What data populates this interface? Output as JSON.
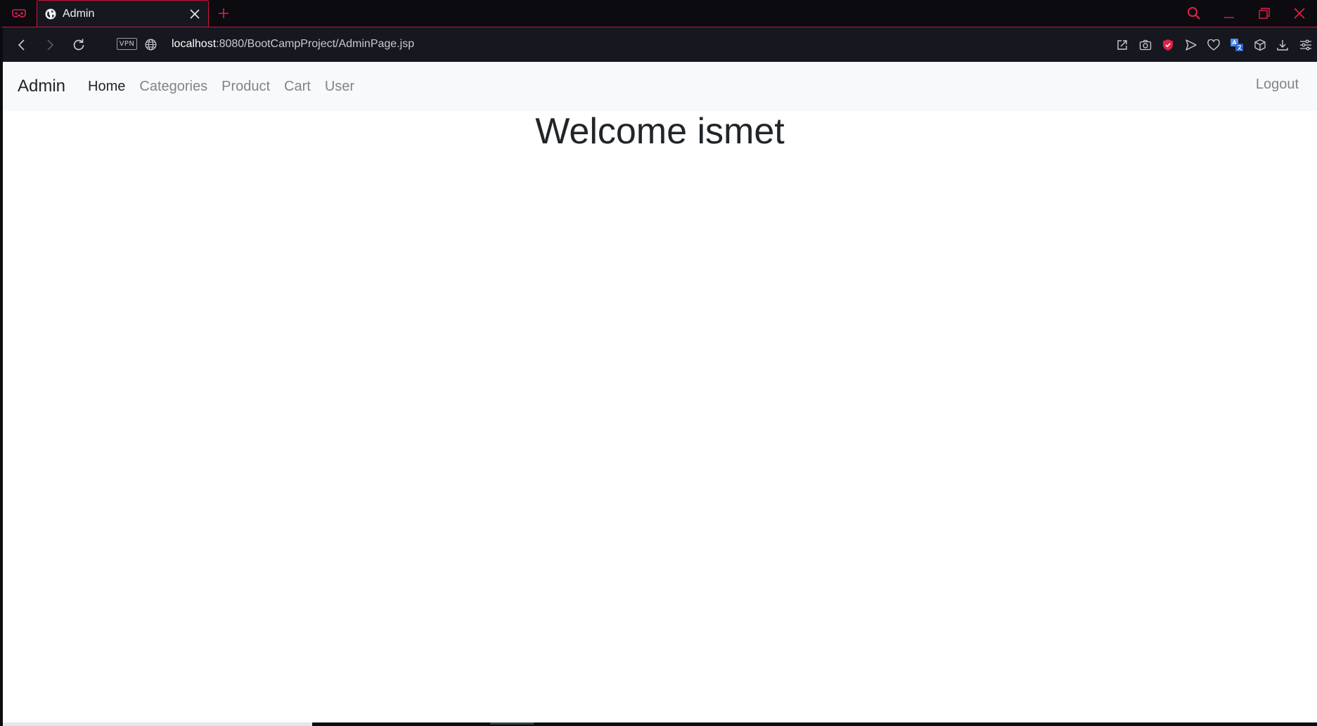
{
  "browser": {
    "tab": {
      "title": "Admin",
      "favicon_icon": "globe-icon"
    },
    "address_bar": {
      "vpn_label": "VPN",
      "url_host": "localhost",
      "url_rest": ":8080/BootCampProject/AdminPage.jsp"
    },
    "toolbar_icons": [
      "share-icon",
      "camera-icon",
      "shield-icon",
      "send-icon",
      "heart-icon",
      "translate-icon",
      "box-icon",
      "download-icon",
      "menu-icon"
    ],
    "accent_color": "#c8163c"
  },
  "page": {
    "navbar": {
      "brand": "Admin",
      "links": [
        {
          "label": "Home",
          "active": true
        },
        {
          "label": "Categories",
          "active": false
        },
        {
          "label": "Product",
          "active": false
        },
        {
          "label": "Cart",
          "active": false
        },
        {
          "label": "User",
          "active": false
        }
      ],
      "logout_label": "Logout"
    },
    "heading": "Welcome ismet"
  }
}
